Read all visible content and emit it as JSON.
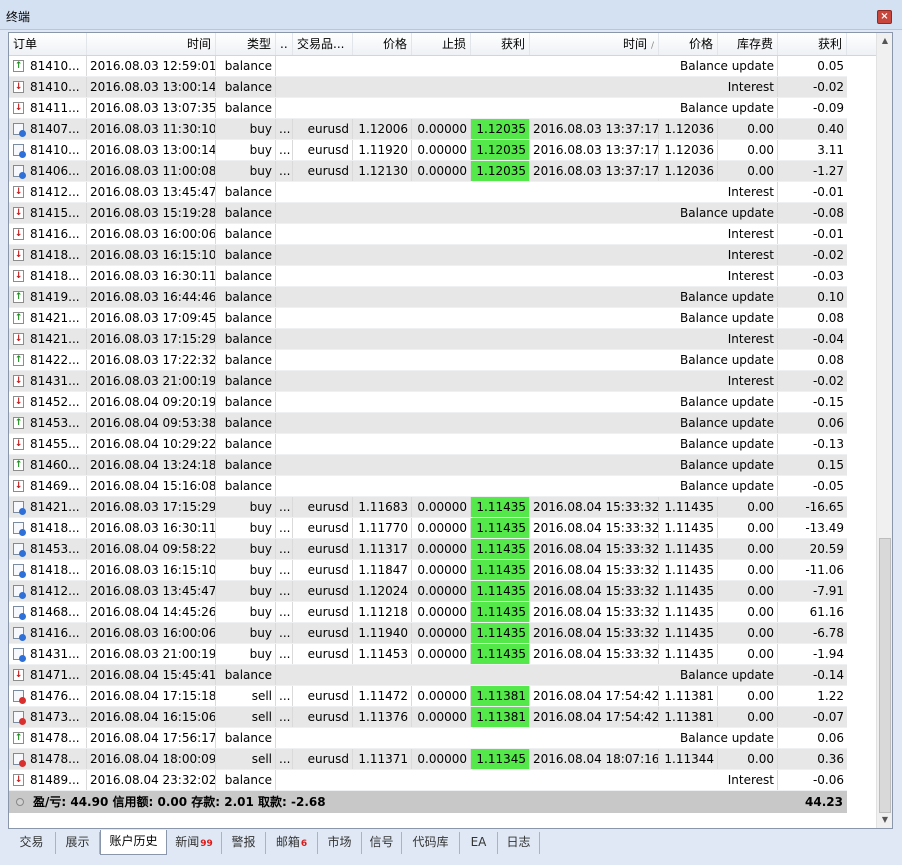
{
  "window": {
    "title": "终端",
    "close_glyph": "×"
  },
  "columns": {
    "order": "订单",
    "open_time": "时间",
    "type": "类型",
    "size": "..",
    "symbol": "交易品...",
    "open_price": "价格",
    "sl": "止损",
    "tp": "获利",
    "close_time": "时间",
    "close_time_sort": "/",
    "close_price": "价格",
    "swap": "库存费",
    "profit": "获利"
  },
  "rows": [
    {
      "icon": "up",
      "order": "81410...",
      "time": "2016.08.03 12:59:01",
      "type": "balance",
      "comment": "Balance update",
      "profit": "0.05"
    },
    {
      "icon": "down",
      "order": "81410...",
      "time": "2016.08.03 13:00:14",
      "type": "balance",
      "comment": "Interest",
      "profit": "-0.02"
    },
    {
      "icon": "down",
      "order": "81411...",
      "time": "2016.08.03 13:07:35",
      "type": "balance",
      "comment": "Balance update",
      "profit": "-0.09"
    },
    {
      "icon": "buy",
      "order": "81407...",
      "time": "2016.08.03 11:30:10",
      "type": "buy",
      "size": "...",
      "symbol": "eurusd",
      "price": "1.12006",
      "sl": "0.00000",
      "tp": "1.12035",
      "close_time": "2016.08.03 13:37:17",
      "close_price": "1.12036",
      "swap": "0.00",
      "profit": "0.40"
    },
    {
      "icon": "buy",
      "order": "81410...",
      "time": "2016.08.03 13:00:14",
      "type": "buy",
      "size": "...",
      "symbol": "eurusd",
      "price": "1.11920",
      "sl": "0.00000",
      "tp": "1.12035",
      "close_time": "2016.08.03 13:37:17",
      "close_price": "1.12036",
      "swap": "0.00",
      "profit": "3.11"
    },
    {
      "icon": "buy",
      "order": "81406...",
      "time": "2016.08.03 11:00:08",
      "type": "buy",
      "size": "...",
      "symbol": "eurusd",
      "price": "1.12130",
      "sl": "0.00000",
      "tp": "1.12035",
      "close_time": "2016.08.03 13:37:17",
      "close_price": "1.12036",
      "swap": "0.00",
      "profit": "-1.27"
    },
    {
      "icon": "down",
      "order": "81412...",
      "time": "2016.08.03 13:45:47",
      "type": "balance",
      "comment": "Interest",
      "profit": "-0.01"
    },
    {
      "icon": "down",
      "order": "81415...",
      "time": "2016.08.03 15:19:28",
      "type": "balance",
      "comment": "Balance update",
      "profit": "-0.08"
    },
    {
      "icon": "down",
      "order": "81416...",
      "time": "2016.08.03 16:00:06",
      "type": "balance",
      "comment": "Interest",
      "profit": "-0.01"
    },
    {
      "icon": "down",
      "order": "81418...",
      "time": "2016.08.03 16:15:10",
      "type": "balance",
      "comment": "Interest",
      "profit": "-0.02"
    },
    {
      "icon": "down",
      "order": "81418...",
      "time": "2016.08.03 16:30:11",
      "type": "balance",
      "comment": "Interest",
      "profit": "-0.03"
    },
    {
      "icon": "up",
      "order": "81419...",
      "time": "2016.08.03 16:44:46",
      "type": "balance",
      "comment": "Balance update",
      "profit": "0.10"
    },
    {
      "icon": "up",
      "order": "81421...",
      "time": "2016.08.03 17:09:45",
      "type": "balance",
      "comment": "Balance update",
      "profit": "0.08"
    },
    {
      "icon": "down",
      "order": "81421...",
      "time": "2016.08.03 17:15:29",
      "type": "balance",
      "comment": "Interest",
      "profit": "-0.04"
    },
    {
      "icon": "up",
      "order": "81422...",
      "time": "2016.08.03 17:22:32",
      "type": "balance",
      "comment": "Balance update",
      "profit": "0.08"
    },
    {
      "icon": "down",
      "order": "81431...",
      "time": "2016.08.03 21:00:19",
      "type": "balance",
      "comment": "Interest",
      "profit": "-0.02"
    },
    {
      "icon": "down",
      "order": "81452...",
      "time": "2016.08.04 09:20:19",
      "type": "balance",
      "comment": "Balance update",
      "profit": "-0.15"
    },
    {
      "icon": "up",
      "order": "81453...",
      "time": "2016.08.04 09:53:38",
      "type": "balance",
      "comment": "Balance update",
      "profit": "0.06"
    },
    {
      "icon": "down",
      "order": "81455...",
      "time": "2016.08.04 10:29:22",
      "type": "balance",
      "comment": "Balance update",
      "profit": "-0.13"
    },
    {
      "icon": "up",
      "order": "81460...",
      "time": "2016.08.04 13:24:18",
      "type": "balance",
      "comment": "Balance update",
      "profit": "0.15"
    },
    {
      "icon": "down",
      "order": "81469...",
      "time": "2016.08.04 15:16:08",
      "type": "balance",
      "comment": "Balance update",
      "profit": "-0.05"
    },
    {
      "icon": "buy",
      "order": "81421...",
      "time": "2016.08.03 17:15:29",
      "type": "buy",
      "size": "...",
      "symbol": "eurusd",
      "price": "1.11683",
      "sl": "0.00000",
      "tp": "1.11435",
      "close_time": "2016.08.04 15:33:32",
      "close_price": "1.11435",
      "swap": "0.00",
      "profit": "-16.65"
    },
    {
      "icon": "buy",
      "order": "81418...",
      "time": "2016.08.03 16:30:11",
      "type": "buy",
      "size": "...",
      "symbol": "eurusd",
      "price": "1.11770",
      "sl": "0.00000",
      "tp": "1.11435",
      "close_time": "2016.08.04 15:33:32",
      "close_price": "1.11435",
      "swap": "0.00",
      "profit": "-13.49"
    },
    {
      "icon": "buy",
      "order": "81453...",
      "time": "2016.08.04 09:58:22",
      "type": "buy",
      "size": "...",
      "symbol": "eurusd",
      "price": "1.11317",
      "sl": "0.00000",
      "tp": "1.11435",
      "close_time": "2016.08.04 15:33:32",
      "close_price": "1.11435",
      "swap": "0.00",
      "profit": "20.59"
    },
    {
      "icon": "buy",
      "order": "81418...",
      "time": "2016.08.03 16:15:10",
      "type": "buy",
      "size": "...",
      "symbol": "eurusd",
      "price": "1.11847",
      "sl": "0.00000",
      "tp": "1.11435",
      "close_time": "2016.08.04 15:33:32",
      "close_price": "1.11435",
      "swap": "0.00",
      "profit": "-11.06"
    },
    {
      "icon": "buy",
      "order": "81412...",
      "time": "2016.08.03 13:45:47",
      "type": "buy",
      "size": "...",
      "symbol": "eurusd",
      "price": "1.12024",
      "sl": "0.00000",
      "tp": "1.11435",
      "close_time": "2016.08.04 15:33:32",
      "close_price": "1.11435",
      "swap": "0.00",
      "profit": "-7.91"
    },
    {
      "icon": "buy",
      "order": "81468...",
      "time": "2016.08.04 14:45:26",
      "type": "buy",
      "size": "...",
      "symbol": "eurusd",
      "price": "1.11218",
      "sl": "0.00000",
      "tp": "1.11435",
      "close_time": "2016.08.04 15:33:32",
      "close_price": "1.11435",
      "swap": "0.00",
      "profit": "61.16"
    },
    {
      "icon": "buy",
      "order": "81416...",
      "time": "2016.08.03 16:00:06",
      "type": "buy",
      "size": "...",
      "symbol": "eurusd",
      "price": "1.11940",
      "sl": "0.00000",
      "tp": "1.11435",
      "close_time": "2016.08.04 15:33:32",
      "close_price": "1.11435",
      "swap": "0.00",
      "profit": "-6.78"
    },
    {
      "icon": "buy",
      "order": "81431...",
      "time": "2016.08.03 21:00:19",
      "type": "buy",
      "size": "...",
      "symbol": "eurusd",
      "price": "1.11453",
      "sl": "0.00000",
      "tp": "1.11435",
      "close_time": "2016.08.04 15:33:32",
      "close_price": "1.11435",
      "swap": "0.00",
      "profit": "-1.94"
    },
    {
      "icon": "down",
      "order": "81471...",
      "time": "2016.08.04 15:45:41",
      "type": "balance",
      "comment": "Balance update",
      "profit": "-0.14"
    },
    {
      "icon": "sell",
      "order": "81476...",
      "time": "2016.08.04 17:15:18",
      "type": "sell",
      "size": "...",
      "symbol": "eurusd",
      "price": "1.11472",
      "sl": "0.00000",
      "tp": "1.11381",
      "close_time": "2016.08.04 17:54:42",
      "close_price": "1.11381",
      "swap": "0.00",
      "profit": "1.22"
    },
    {
      "icon": "sell",
      "order": "81473...",
      "time": "2016.08.04 16:15:06",
      "type": "sell",
      "size": "...",
      "symbol": "eurusd",
      "price": "1.11376",
      "sl": "0.00000",
      "tp": "1.11381",
      "close_time": "2016.08.04 17:54:42",
      "close_price": "1.11381",
      "swap": "0.00",
      "profit": "-0.07"
    },
    {
      "icon": "up",
      "order": "81478...",
      "time": "2016.08.04 17:56:17",
      "type": "balance",
      "comment": "Balance update",
      "profit": "0.06"
    },
    {
      "icon": "sell",
      "order": "81478...",
      "time": "2016.08.04 18:00:09",
      "type": "sell",
      "size": "...",
      "symbol": "eurusd",
      "price": "1.11371",
      "sl": "0.00000",
      "tp": "1.11345",
      "close_time": "2016.08.04 18:07:16",
      "close_price": "1.11344",
      "swap": "0.00",
      "profit": "0.36"
    },
    {
      "icon": "down",
      "order": "81489...",
      "time": "2016.08.04 23:32:02",
      "type": "balance",
      "comment": "Interest",
      "profit": "-0.06"
    }
  ],
  "footer": {
    "summary": "盈/亏: 44.90  信用额: 0.00  存款: 2.01  取款: -2.68",
    "total": "44.23"
  },
  "tabs": [
    {
      "label": "交易"
    },
    {
      "label": "展示"
    },
    {
      "label": "账户历史",
      "active": true
    },
    {
      "label": "新闻",
      "badge": "99"
    },
    {
      "label": "警报"
    },
    {
      "label": "邮箱",
      "badge": "6"
    },
    {
      "label": "市场"
    },
    {
      "label": "信号"
    },
    {
      "label": "代码库"
    },
    {
      "label": "EA"
    },
    {
      "label": "日志"
    }
  ],
  "icons": {
    "up": "arrow-up-icon",
    "down": "arrow-down-icon",
    "buy": "buy-order-icon",
    "sell": "sell-order-icon",
    "scroll_up": "▲",
    "scroll_down": "▼"
  },
  "colors": {
    "tp_highlight": "#55e84a",
    "row_alt": "#e7e7e7",
    "footer": "#c8c8c8"
  }
}
